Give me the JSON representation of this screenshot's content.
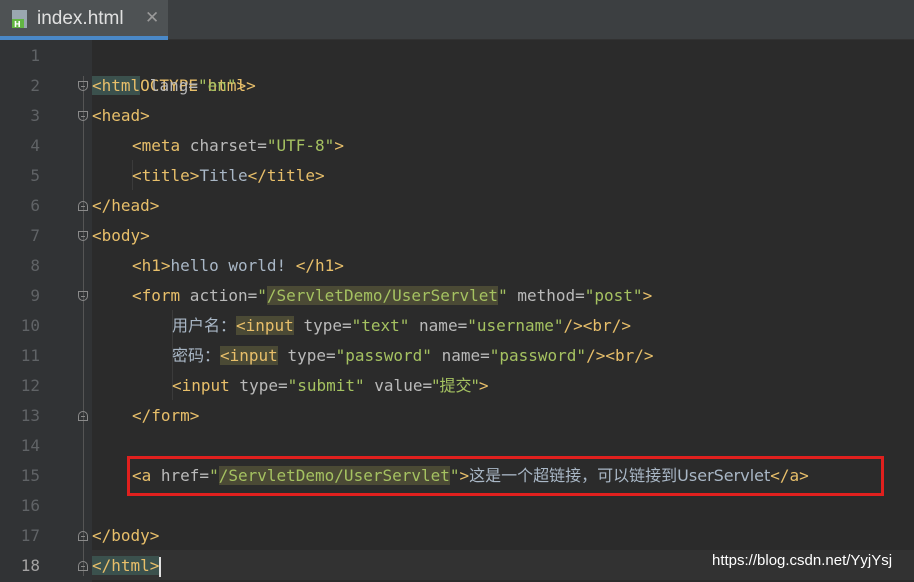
{
  "tab": {
    "title": "index.html",
    "close": "✕",
    "icon": "html-file-icon"
  },
  "line_numbers": [
    "1",
    "2",
    "3",
    "4",
    "5",
    "6",
    "7",
    "8",
    "9",
    "10",
    "11",
    "12",
    "13",
    "14",
    "15",
    "16",
    "17",
    "18"
  ],
  "code": {
    "l1": "<!DOCTYPE html>",
    "l2": {
      "open": "<html",
      "attr": " lang=",
      "val": "\"en\"",
      "close": ">"
    },
    "l3": "<head>",
    "l4": {
      "open": "<meta",
      "attr": " charset=",
      "val": "\"UTF-8\"",
      "close": ">"
    },
    "l5": {
      "open": "<title>",
      "text": "Title",
      "close": "</title>"
    },
    "l6": "</head>",
    "l7": "<body>",
    "l8": {
      "open": "<h1>",
      "text": "hello world! ",
      "close": "</h1>"
    },
    "l9": {
      "open": "<form",
      "attr1": " action=",
      "q1": "\"",
      "val1": "/ServletDemo/UserServlet",
      "q2": "\"",
      "attr2": " method=",
      "val2": "\"post\"",
      "close": ">"
    },
    "l10": {
      "text": "用户名：",
      "open": "<input",
      "attr1": " type=",
      "val1": "\"text\"",
      "attr2": " name=",
      "val2": "\"username\"",
      "close": "/><br/>"
    },
    "l11": {
      "text": "密码：",
      "open": "<input",
      "attr1": " type=",
      "val1": "\"password\"",
      "attr2": " name=",
      "val2": "\"password\"",
      "close": "/><br/>"
    },
    "l12": {
      "open": "<input",
      "attr1": " type=",
      "val1": "\"submit\"",
      "attr2": " value=",
      "val2": "\"提交\"",
      "close": ">"
    },
    "l13": "</form>",
    "l15": {
      "open": "<a",
      "attr": " href=",
      "q1": "\"",
      "val": "/ServletDemo/UserServlet",
      "q2": "\"",
      "gt": ">",
      "text": "这是一个超链接，可以链接到UserServlet",
      "close": "</a>"
    },
    "l17": "</body>",
    "l18": "</html>"
  },
  "watermark": "https://blog.csdn.net/YyjYsj"
}
